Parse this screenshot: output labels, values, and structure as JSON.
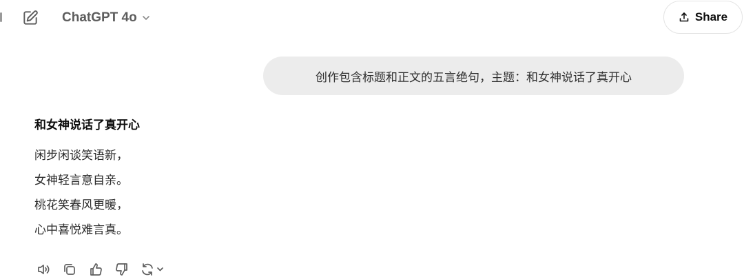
{
  "header": {
    "model_name": "ChatGPT 4o",
    "share_label": "Share"
  },
  "conversation": {
    "user_message": "创作包含标题和正文的五言绝句，主题：和女神说话了真开心",
    "assistant": {
      "title": "和女神说话了真开心",
      "lines": [
        "闲步闲谈笑语新，",
        "女神轻言意自亲。",
        "桃花笑春风更暖，",
        "心中喜悦难言真。"
      ]
    }
  },
  "actions": [
    "read-aloud-icon",
    "copy-icon",
    "thumbs-up-icon",
    "thumbs-down-icon",
    "regenerate-icon"
  ]
}
